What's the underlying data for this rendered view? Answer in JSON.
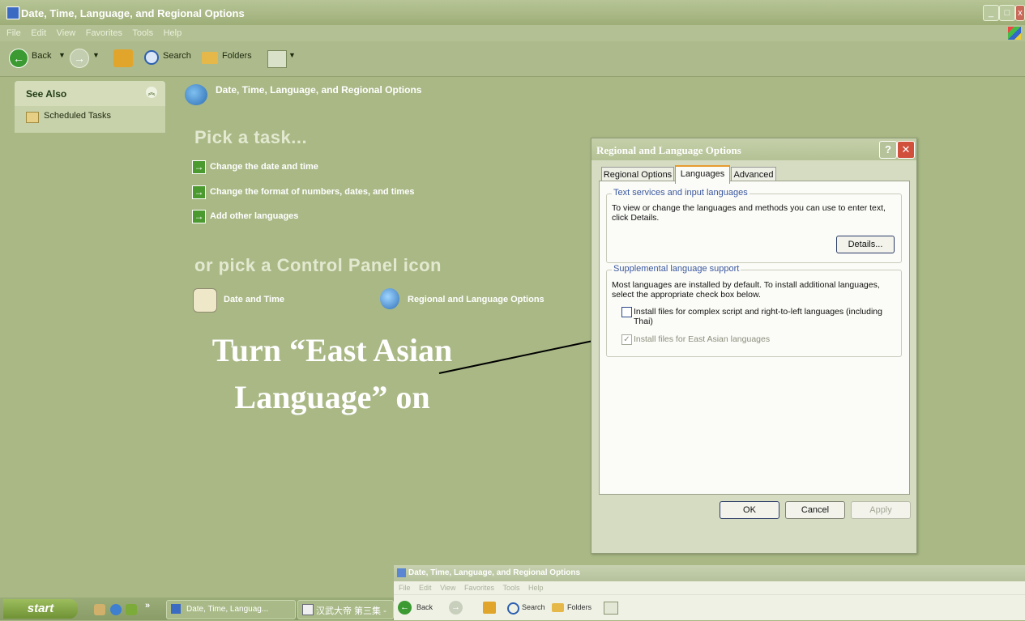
{
  "window": {
    "title": "Date, Time, Language, and Regional Options",
    "menu": [
      "File",
      "Edit",
      "View",
      "Favorites",
      "Tools",
      "Help"
    ]
  },
  "toolbar": {
    "back": "Back",
    "search": "Search",
    "folders": "Folders"
  },
  "see_also": {
    "title": "See Also",
    "items": [
      "Scheduled Tasks"
    ]
  },
  "main": {
    "category_title": "Date, Time, Language, and Regional Options",
    "pick_task": "Pick a task...",
    "tasks": [
      "Change the date and time",
      "Change the format of numbers, dates, and times",
      "Add other languages"
    ],
    "pick_icon": "or pick a Control Panel icon",
    "icons": [
      "Date and Time",
      "Regional and Language Options"
    ]
  },
  "annotation": {
    "line1": "Turn “East Asian",
    "line2": "Language” on"
  },
  "dialog": {
    "title": "Regional and Language Options",
    "help": "?",
    "close": "✕",
    "tabs": [
      "Regional Options",
      "Languages",
      "Advanced"
    ],
    "active_tab": "Languages",
    "group1": {
      "label": "Text services and input languages",
      "text": "To view or change the languages and methods you can use to enter text, click Details.",
      "button": "Details..."
    },
    "group2": {
      "label": "Supplemental language support",
      "text": "Most languages are installed by default. To install additional languages, select the appropriate check box below.",
      "checkbox1": "Install files for complex script and right-to-left languages (including Thai)",
      "checkbox2": "Install files for East Asian languages"
    },
    "buttons": {
      "ok": "OK",
      "cancel": "Cancel",
      "apply": "Apply"
    }
  },
  "taskbar": {
    "start": "start",
    "chevron": "»",
    "tasks": [
      "Date, Time, Languag...",
      "汉武大帝 第三集 -"
    ]
  },
  "overlay_window": {
    "title": "Date, Time, Language, and Regional Options",
    "menu": [
      "File",
      "Edit",
      "View",
      "Favorites",
      "Tools",
      "Help"
    ],
    "back": "Back",
    "search": "Search",
    "folders": "Folders"
  }
}
